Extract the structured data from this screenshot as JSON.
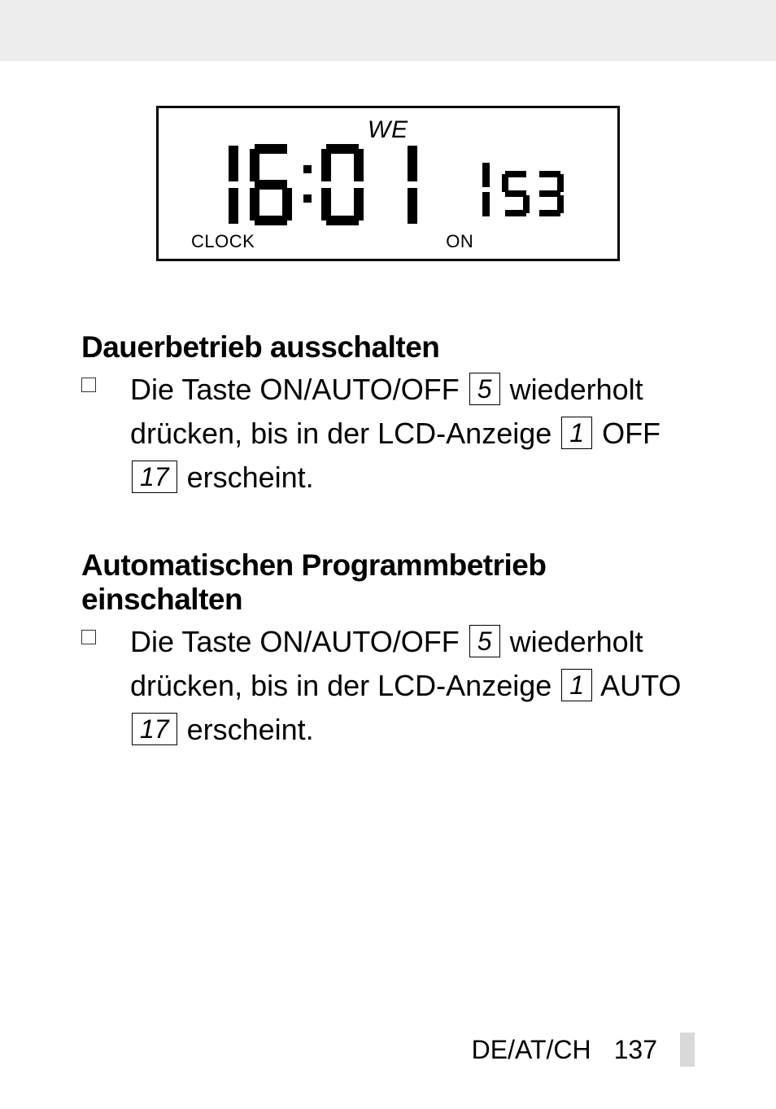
{
  "lcd": {
    "day": "WE",
    "time_main": "16:01",
    "time_sec": "53",
    "label_left": "CLOCK",
    "label_right": "ON"
  },
  "section1": {
    "title": "Dauerbetrieb ausschalten",
    "t1": "Die Taste ON/AUTO/OFF ",
    "k1": "5",
    "t2": " wiederholt drücken, bis in der LCD-Anzeige ",
    "k2": "1",
    "t3": " OFF ",
    "k3": "17",
    "t4": " erscheint."
  },
  "section2": {
    "title": "Automatischen Programmbetrieb einschalten",
    "t1": "Die Taste ON/AUTO/OFF ",
    "k1": "5",
    "t2": " wiederholt drücken, bis in der LCD-Anzeige ",
    "k2": "1",
    "t3": " AUTO ",
    "k3": "17",
    "t4": " erscheint."
  },
  "footer": {
    "locale": "DE/AT/CH",
    "page": "137"
  }
}
